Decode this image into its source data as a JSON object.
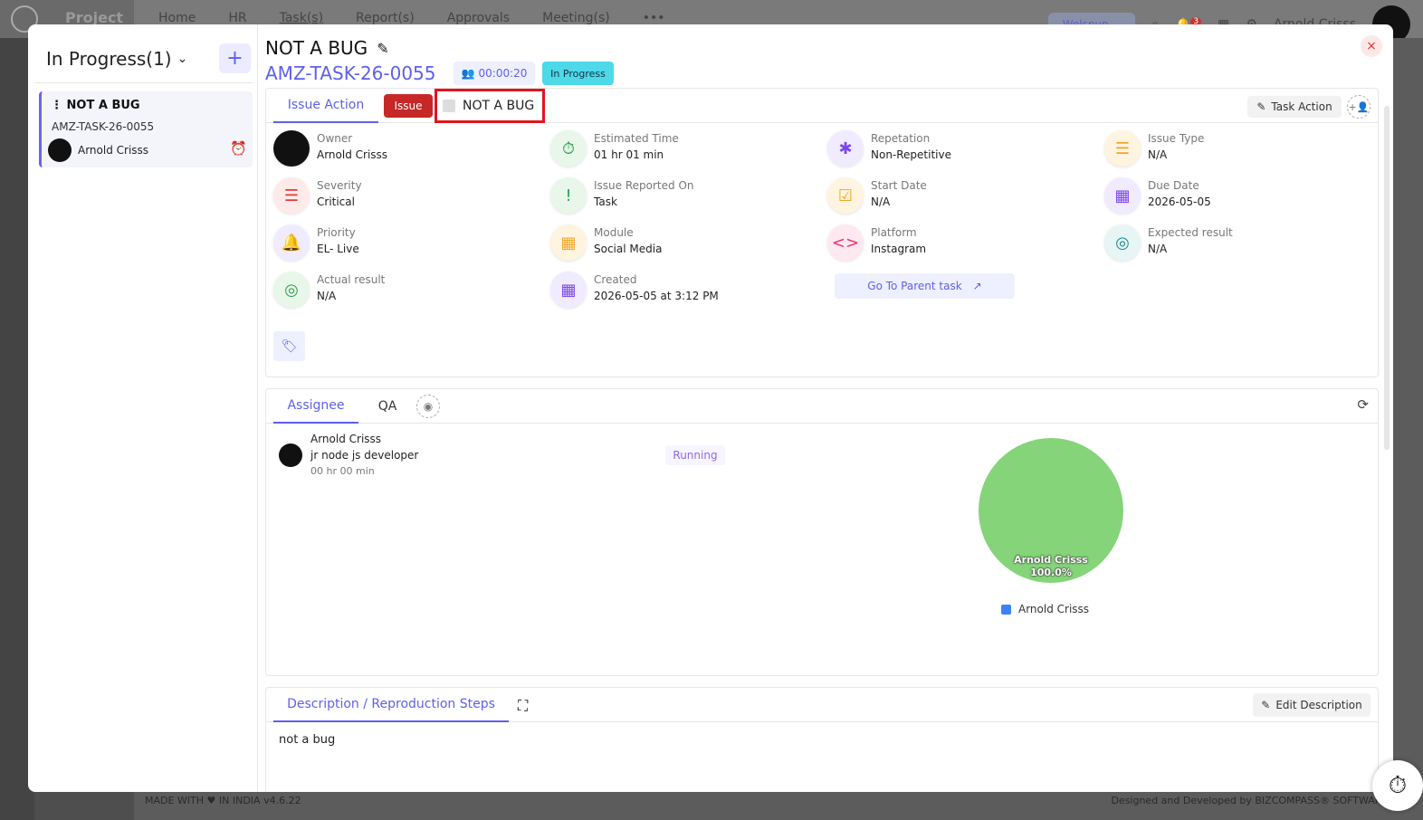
{
  "background": {
    "brand": "Project",
    "nav": [
      "Home",
      "HR",
      "Task(s)",
      "Report(s)",
      "Approvals",
      "Meeting(s)",
      "•••"
    ],
    "company": "Welspun",
    "notifications": "3",
    "user_name": "Arnold Crisss",
    "footer_left": "MADE WITH ♥ IN INDIA v4.6.22",
    "footer_right": "Designed and Developed by BIZCOMPASS® SOFTWARES PV"
  },
  "modal": {
    "close_icon": "×",
    "left": {
      "status_title": "In Progress(1)",
      "add_label": "+",
      "card": {
        "title": "⋮ NOT A BUG",
        "code": "AMZ-TASK-26-0055",
        "owner": "Arnold Crisss"
      }
    },
    "header": {
      "title": "NOT A BUG",
      "code": "AMZ-TASK-26-0055",
      "timer": "00:00:20",
      "status": "In Progress"
    },
    "details": {
      "tab_active": "Issue Action",
      "issue_badge": "Issue",
      "not_bug_label": "NOT A BUG",
      "task_action_label": "Task Action",
      "fields": [
        {
          "label": "Owner",
          "value": "Arnold Crisss",
          "icon": "avatar"
        },
        {
          "label": "Estimated Time",
          "value": "01 hr 01 min",
          "icon": "stopwatch-icon"
        },
        {
          "label": "Repetation",
          "value": "Non-Repetitive",
          "icon": "bug-icon"
        },
        {
          "label": "Issue Type",
          "value": "N/A",
          "icon": "list-icon"
        },
        {
          "label": "Severity",
          "value": "Critical",
          "icon": "severity-icon"
        },
        {
          "label": "Issue Reported On",
          "value": "Task",
          "icon": "clipboard-icon"
        },
        {
          "label": "Start Date",
          "value": "N/A",
          "icon": "calendar-check-icon"
        },
        {
          "label": "Due Date",
          "value": "2026-05-05",
          "icon": "calendar-icon"
        },
        {
          "label": "Priority",
          "value": "EL- Live",
          "icon": "bell-icon"
        },
        {
          "label": "Module",
          "value": "Social Media",
          "icon": "grid-icon"
        },
        {
          "label": "Platform",
          "value": "Instagram",
          "icon": "code-icon"
        },
        {
          "label": "Expected result",
          "value": "N/A",
          "icon": "target-icon"
        },
        {
          "label": "Actual result",
          "value": "N/A",
          "icon": "target-icon"
        },
        {
          "label": "Created",
          "value": "2026-05-05 at 3:12 PM",
          "icon": "calendar-icon"
        }
      ],
      "parent_task_label": "Go To Parent task"
    },
    "assignee": {
      "tabs": [
        "Assignee",
        "QA"
      ],
      "name": "Arnold Crisss",
      "role": "jr node js developer",
      "time": "00 hr 00 min",
      "status": "Running",
      "pie_label_name": "Arnold Crisss",
      "pie_label_pct": "100.0%",
      "legend": "Arnold Crisss",
      "pie_color": "#86d47a",
      "legend_color": "#3b82f6"
    },
    "description": {
      "tab": "Description / Reproduction Steps",
      "edit_label": "Edit Description",
      "text": "not a bug"
    }
  },
  "chart_data": {
    "type": "pie",
    "slices": [
      {
        "name": "Arnold Crisss",
        "value": 100.0
      }
    ],
    "title": "",
    "legend": [
      "Arnold Crisss"
    ]
  }
}
